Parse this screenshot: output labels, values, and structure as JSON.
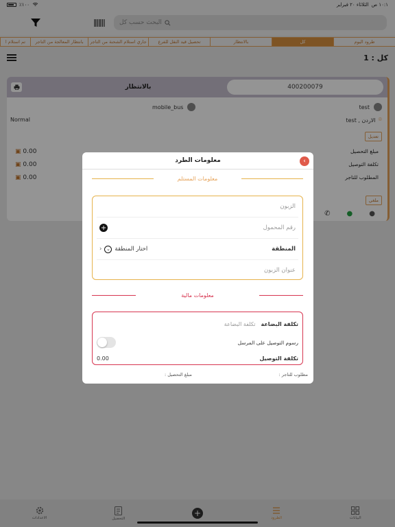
{
  "status_bar": {
    "time": "١٠:١ ص",
    "date": "الثلاثاء ٢٠ فبراير",
    "battery": "٪١٠٠"
  },
  "search": {
    "placeholder": "البحث حسب كل"
  },
  "tabs": [
    {
      "label": "طرود اليوم",
      "active": false
    },
    {
      "label": "كل",
      "active": true
    },
    {
      "label": "بالانتظار",
      "active": false
    },
    {
      "label": "تحصيل قيد النقل للفرع",
      "active": false
    },
    {
      "label": "جاري استلام الشحنة من التاجر",
      "active": false
    },
    {
      "label": "بانتظار المعالجة من التاجر",
      "active": false
    },
    {
      "label": "تم استلام ا",
      "active": false
    }
  ],
  "count_label": "كل : 1",
  "card": {
    "status": "بالانتظار",
    "id": "400200079",
    "customer_name": "test",
    "driver_name": "mobile_bus",
    "location": "الاردن , test",
    "priority": "Normal",
    "edit_label": "تعديل",
    "rows": [
      {
        "label": "مبلغ التحصيل",
        "value": "0.00"
      },
      {
        "label": "تكلفة التوصيل",
        "value": "0.00"
      },
      {
        "label": "المطلوب للتاجر",
        "value": "0.00"
      }
    ],
    "cancel_label": "ملغي"
  },
  "modal": {
    "title": "معلومات الطرد",
    "recipient_section": "معلومات المستلم",
    "fields": {
      "customer_placeholder": "الزبون",
      "phone_placeholder": "رقم المحمول",
      "region_label": "المنطقة",
      "region_select": "اختار المنطقة",
      "address_placeholder": "عنوان الزبون"
    },
    "financial_section": "معلومات مالية",
    "financial": {
      "goods_cost_label": "تكلفة البضاعة",
      "goods_cost_placeholder": "تكلفة البضاعة",
      "sender_fee_label": "رسوم التوصيل على المرسل",
      "delivery_cost_label": "تكلفة التوصيل",
      "delivery_cost_value": "0.00"
    },
    "footer": {
      "merchant_required": "مطلوب للتاجر :",
      "collection_amount": "مبلغ التحصيل :"
    }
  },
  "bottom_nav": [
    {
      "label": "البيانات",
      "icon": "grid-icon",
      "active": false
    },
    {
      "label": "الطرود",
      "icon": "list-icon",
      "active": true
    },
    {
      "label": "",
      "icon": "add-icon",
      "active": false
    },
    {
      "label": "التحصيل",
      "icon": "document-icon",
      "active": false
    },
    {
      "label": "الاعدادات",
      "icon": "settings-icon",
      "active": false
    }
  ],
  "colors": {
    "accent": "#d9913f",
    "financial_accent": "#d7344f",
    "close_button": "#e05a4a",
    "card_header": "#c7c0cf"
  }
}
